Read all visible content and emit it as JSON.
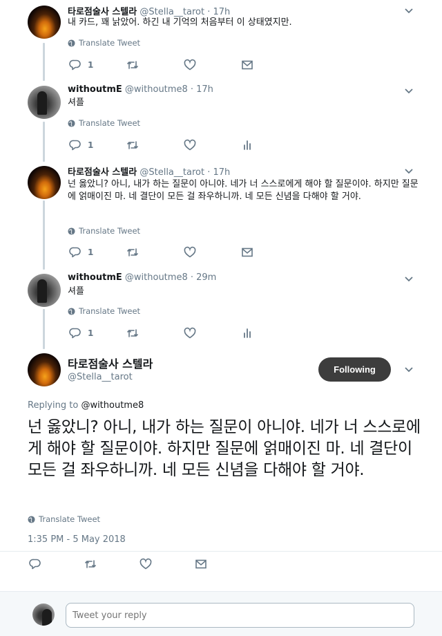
{
  "tweets": [
    {
      "name": "타로점술사 스텔라",
      "handle": "@Stella__tarot",
      "time": "· 17h",
      "text": "내 카드, 꽤 낡았어. 하긴 내 기억의 처음부터 이 상태였지만.",
      "translate": "Translate Tweet",
      "reply_count": "1",
      "fourth_action": "mail-icon"
    },
    {
      "name": "withoutmE",
      "handle": "@withoutme8",
      "time": "· 17h",
      "text": "셔플",
      "translate": "Translate Tweet",
      "reply_count": "1",
      "fourth_action": "analytics-icon"
    },
    {
      "name": "타로점술사 스텔라",
      "handle": "@Stella__tarot",
      "time": "· 17h",
      "text": "넌 옳았니? 아니, 내가 하는 질문이 아니야. 네가 너 스스로에게 해야 할 질문이야. 하지만 질문에 얽매이진 마. 네 결단이 모든 걸 좌우하니까. 네 모든 신념을 다해야 할 거야.",
      "translate": "Translate Tweet",
      "reply_count": "1",
      "fourth_action": "mail-icon"
    },
    {
      "name": "withoutmE",
      "handle": "@withoutme8",
      "time": "· 29m",
      "text": "셔플",
      "translate": "Translate Tweet",
      "reply_count": "1",
      "fourth_action": "analytics-icon"
    }
  ],
  "main": {
    "name": "타로점술사 스텔라",
    "handle": "@Stella__tarot",
    "follow_label": "Following",
    "replying_prefix": "Replying to",
    "replying_to": "@withoutme8",
    "text": "넌 옳았니? 아니, 내가 하는 질문이 아니야. 네가 너 스스로에게 해야 할 질문이야. 하지만 질문에 얽매이진 마. 네 결단이 모든 걸 좌우하니까. 네 모든 신념을 다해야 할 거야.",
    "translate": "Translate Tweet",
    "timestamp": "1:35 PM - 5 May 2018"
  },
  "reply_box": {
    "placeholder": "Tweet your reply"
  },
  "colors": {
    "text": "#14171a",
    "secondary": "#657786",
    "following_button": "#3d3d3d",
    "divider": "#e6ecf0"
  }
}
